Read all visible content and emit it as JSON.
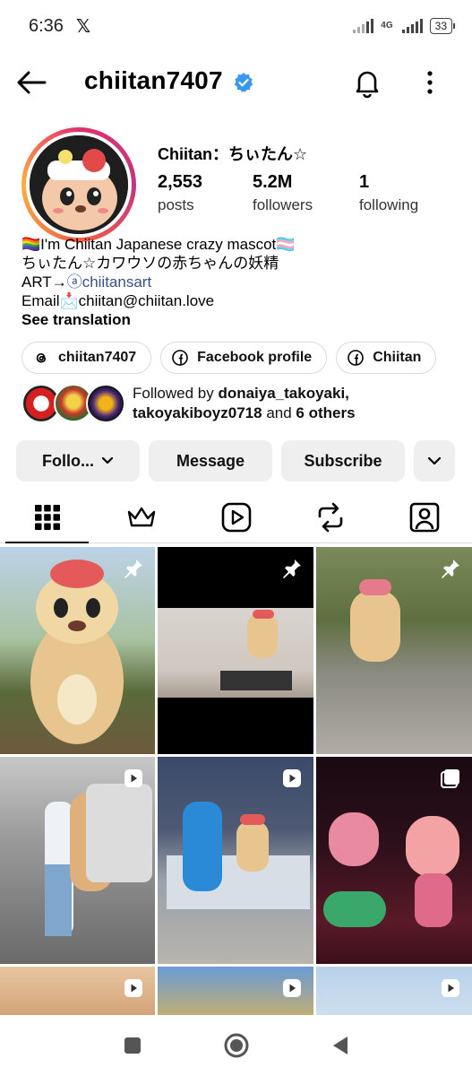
{
  "status": {
    "time": "6:36",
    "x_logo": "𝕏",
    "network": "4G",
    "battery": "33"
  },
  "header": {
    "username": "chiitan7407"
  },
  "profile": {
    "display_name": "Chiitan：ちぃたん☆",
    "stats": [
      {
        "value": "2,553",
        "label": "posts"
      },
      {
        "value": "5.2M",
        "label": "followers"
      },
      {
        "value": "1",
        "label": "following"
      }
    ],
    "bio_line1": "🏳️‍🌈I'm Chiitan Japanese crazy mascot🏳️‍⚧️",
    "bio_line2": "ちぃたん☆カワウソの赤ちゃんの妖精",
    "bio_line3_prefix": "ART→",
    "bio_line3_link": "ⓐchiitansart",
    "bio_line4": "Email📩chiitan@chiitan.love",
    "see_translation": "See translation"
  },
  "chips": [
    {
      "label": "chiitan7407",
      "icon": "threads-icon"
    },
    {
      "label": "Facebook profile",
      "icon": "facebook-icon"
    },
    {
      "label": "Chiitan",
      "icon": "facebook-icon"
    }
  ],
  "followed_by": {
    "prefix": "Followed by ",
    "names1": "donaiya_takoyaki,",
    "names2": "takoyakiboyz0718",
    "and": " and ",
    "others": "6 others"
  },
  "actions": {
    "follow": "Follo...",
    "message": "Message",
    "subscribe": "Subscribe"
  },
  "colors": {
    "link": "#385185",
    "verified": "#3897f0",
    "button_bg": "#efefef"
  }
}
